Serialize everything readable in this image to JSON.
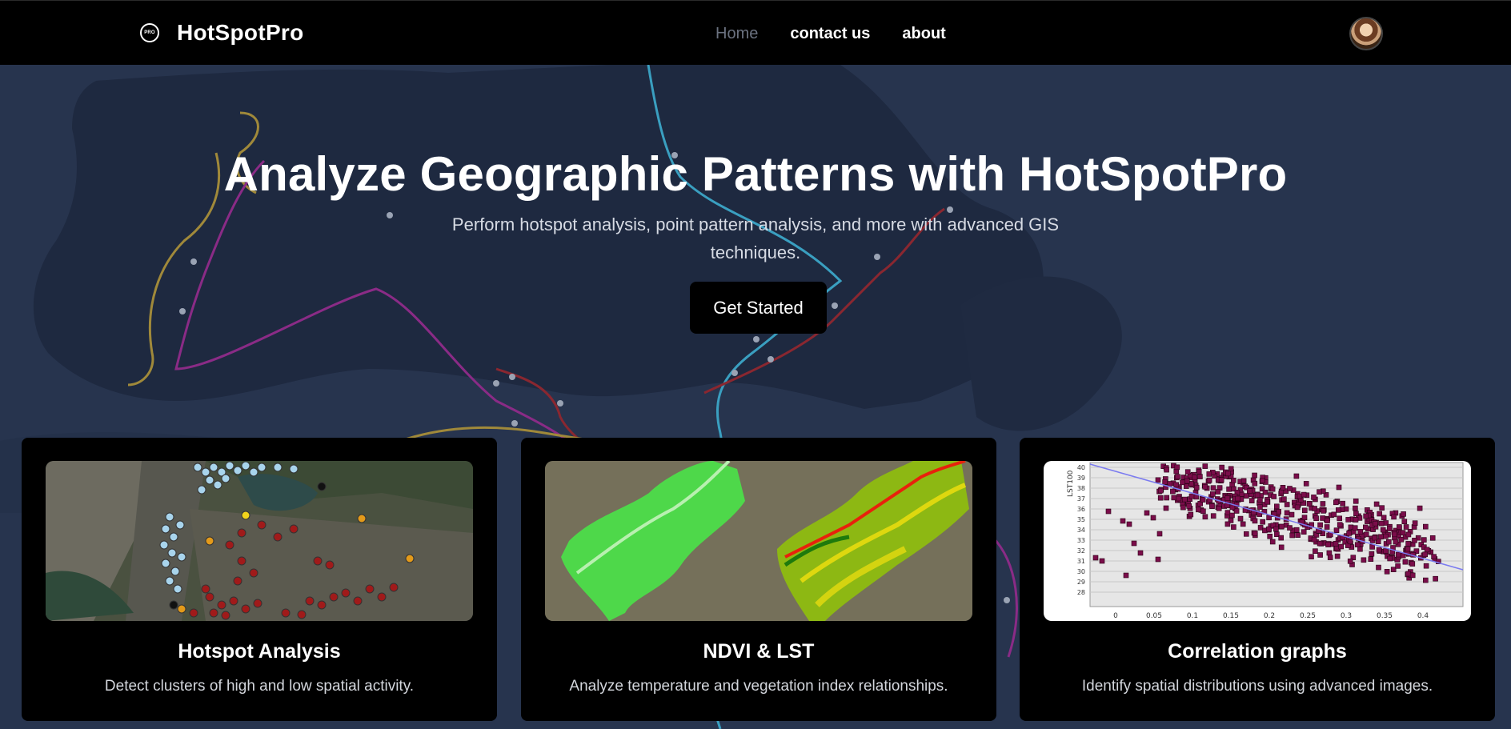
{
  "navbar": {
    "brand_logo_text": "PRO",
    "brand_name": "HotSpotPro",
    "links": [
      "Home",
      "contact us",
      "about"
    ],
    "active_link": "Home"
  },
  "hero": {
    "title": "Analyze Geographic Patterns with HotSpotPro",
    "subtitle": "Perform hotspot analysis, point pattern analysis, and more with advanced GIS techniques.",
    "cta_label": "Get Started"
  },
  "cards": [
    {
      "title": "Hotspot Analysis",
      "description": "Detect clusters of high and low spatial activity.",
      "image": "hotspot-map-image"
    },
    {
      "title": "NDVI & LST",
      "description": "Analyze temperature and vegetation index relationships.",
      "image": "ndvi-lst-map-image"
    },
    {
      "title": "Correlation graphs",
      "description": "Identify spatial distributions using advanced images.",
      "image": "correlation-scatter-image"
    }
  ],
  "correlation_chart": {
    "ylabel": "LST100",
    "x_ticks": [
      "0",
      "0.05",
      "0.1",
      "0.15",
      "0.2",
      "0.25",
      "0.3",
      "0.35",
      "0.4"
    ],
    "y_ticks": [
      "40",
      "39",
      "38",
      "37",
      "36",
      "35",
      "34",
      "33",
      "32",
      "31",
      "30",
      "29",
      "28"
    ]
  },
  "colors": {
    "nav_bg": "#000000",
    "hero_bg": "#283650",
    "card_bg": "#000000",
    "nav_inactive": "#6b7280"
  }
}
